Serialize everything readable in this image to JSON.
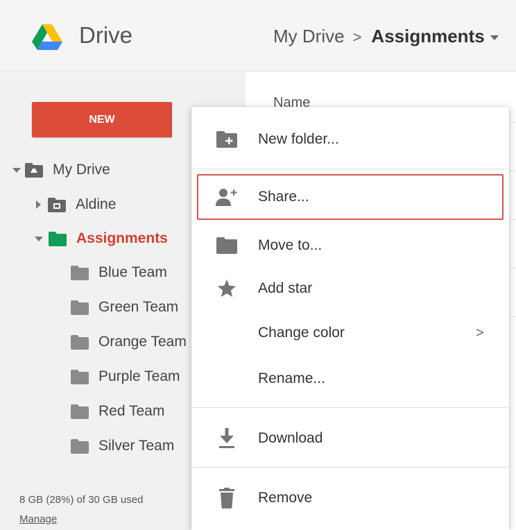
{
  "header": {
    "app_title": "Drive",
    "breadcrumb": {
      "root": "My Drive",
      "separator": ">",
      "current": "Assignments"
    }
  },
  "sidebar": {
    "new_label": "NEW",
    "tree": {
      "my_drive": "My Drive",
      "aldine": "Aldine",
      "assignments": "Assignments",
      "folders": [
        "Blue Team",
        "Green Team",
        "Orange Team",
        "Purple Team",
        "Red Team",
        "Silver Team"
      ]
    },
    "storage": "8 GB (28%) of 30 GB used",
    "manage_label": "Manage"
  },
  "main": {
    "column_name": "Name"
  },
  "context_menu": {
    "items": {
      "new_folder": "New folder...",
      "share": "Share...",
      "move_to": "Move to...",
      "add_star": "Add star",
      "change_color": "Change color",
      "change_color_chevron": ">",
      "rename": "Rename...",
      "download": "Download",
      "remove": "Remove"
    },
    "highlighted_item": "share"
  },
  "colors": {
    "new_button": "#dd4b39",
    "assignments_text": "#d23f31",
    "assignments_folder": "#0f9d58",
    "highlight_border": "#d9534f",
    "folder_gray": "#8a8a8a"
  },
  "icons": {
    "logo": "google-drive-logo",
    "new_folder": "folder-plus-icon",
    "share": "person-add-icon",
    "move_to": "folder-icon",
    "add_star": "star-icon",
    "download": "download-icon",
    "remove": "trash-icon"
  }
}
